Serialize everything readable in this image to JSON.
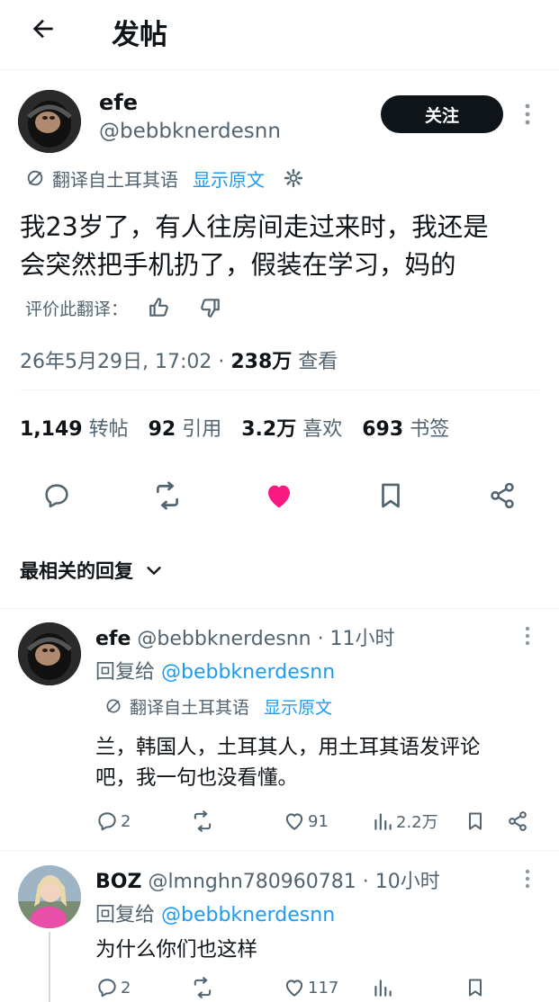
{
  "header": {
    "title": "发帖"
  },
  "post": {
    "name": "efe",
    "handle": "@bebbknerdesnn",
    "follow_label": "关注",
    "translated_from": "翻译自土耳其语",
    "show_original": "显示原文",
    "text_line1": "我23岁了，有人往房间走过来时，我还是",
    "text_line2": "会突然把手机扔了，假装在学习，妈的",
    "rate_translation": "评价此翻译：",
    "datetime": "26年5月29日, 17:02 · ",
    "views_num": "238万",
    "views_label": " 查看",
    "stats": [
      {
        "num": "1,149",
        "label": "转帖"
      },
      {
        "num": "92",
        "label": "引用"
      },
      {
        "num": "3.2万",
        "label": "喜欢"
      },
      {
        "num": "693",
        "label": "书签"
      }
    ],
    "liked": true,
    "like_color": "#f91880"
  },
  "replies_header": {
    "label": "最相关的回复"
  },
  "replies": [
    {
      "name": "efe",
      "handle": "@bebbknerdesnn",
      "time": " · 11小时",
      "reply_to_prefix": "回复给 ",
      "reply_to_handle": "@bebbknerdesnn",
      "translated_from": "翻译自土耳其语",
      "show_original": "显示原文",
      "text_line1": "兰，韩国人，土耳其人，用土耳其语发评论",
      "text_line2": "吧，我一句也没看懂。",
      "comments": "2",
      "likes": "91",
      "views": "2.2万"
    },
    {
      "name": "BOZ",
      "handle": "@lmnghn780960781",
      "time": " · 10小时",
      "reply_to_prefix": "回复给 ",
      "reply_to_handle": "@bebbknerdesnn",
      "text_line1": "为什么你们也这样",
      "comments": "2",
      "likes": "117"
    }
  ]
}
